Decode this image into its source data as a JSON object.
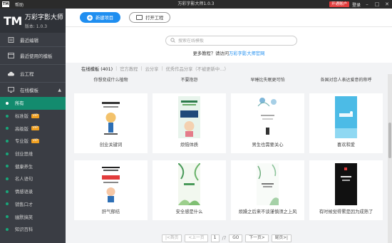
{
  "titlebar": {
    "menu_help": "帮助",
    "title": "万彩字影大师1.0.3",
    "vip": "开通账户",
    "login": "登录",
    "ctrl_min": "–",
    "ctrl_max": "□",
    "ctrl_close": "✕"
  },
  "brand": {
    "mark": "TM",
    "name": "万彩字影大师",
    "version": "版本: 1.0.3"
  },
  "sidebar": {
    "recent_edit": "最近编辑",
    "recent_templates": "最近使用的模板",
    "cloud_projects": "云工程",
    "online_templates": "在线模板",
    "sub_items": [
      {
        "label": "所有",
        "vip": ""
      },
      {
        "label": "标准版",
        "vip": "VIP"
      },
      {
        "label": "高级版",
        "vip": "VIP"
      },
      {
        "label": "专业版",
        "vip": "VIP"
      },
      {
        "label": "创业思维",
        "vip": ""
      },
      {
        "label": "健康养生",
        "vip": ""
      },
      {
        "label": "名人语句",
        "vip": ""
      },
      {
        "label": "情感语录",
        "vip": ""
      },
      {
        "label": "销售口才",
        "vip": ""
      },
      {
        "label": "幽默搞笑",
        "vip": ""
      },
      {
        "label": "知识百科",
        "vip": ""
      }
    ]
  },
  "toolbar": {
    "new_project": "新建项目",
    "open_project": "打开工程"
  },
  "search": {
    "placeholder": "搜索在线模板",
    "tutorial_prefix": "更多教程？请访问",
    "tutorial_link": "万彩字影大师官网"
  },
  "tabs": [
    {
      "label": "在线模板 (401)"
    },
    {
      "label": "官方教程"
    },
    {
      "label": "云分享"
    },
    {
      "label": "优秀作品分享（不被更新中…）"
    }
  ],
  "top_captions": [
    "你想变成什么植物",
    "不要抱怨",
    "早睡比失眠更可怕",
    "各国对恋人表达爱意的称呼"
  ],
  "cards": [
    {
      "caption": "创业关键词"
    },
    {
      "caption": "烦恼体质"
    },
    {
      "caption": "男生也需要关心"
    },
    {
      "caption": "喜欢和爱"
    },
    {
      "caption": "肝气郁结"
    },
    {
      "caption": "安全感是什么"
    },
    {
      "caption": "烦躁之后来不谈谨慎须之上风"
    },
    {
      "caption": "有时候觉得累是因为成熟了"
    }
  ],
  "pager": {
    "first": "|<首页",
    "prev": "<上一页",
    "page": "1",
    "total": "/7",
    "go": "GO",
    "next": "下一页>",
    "last": "尾页>|"
  },
  "colors": {
    "accent": "#1f8ef0",
    "sidebar_bg": "#3a3d44",
    "sidebar_active": "#138b6e",
    "vip_red": "#e23c3c"
  }
}
